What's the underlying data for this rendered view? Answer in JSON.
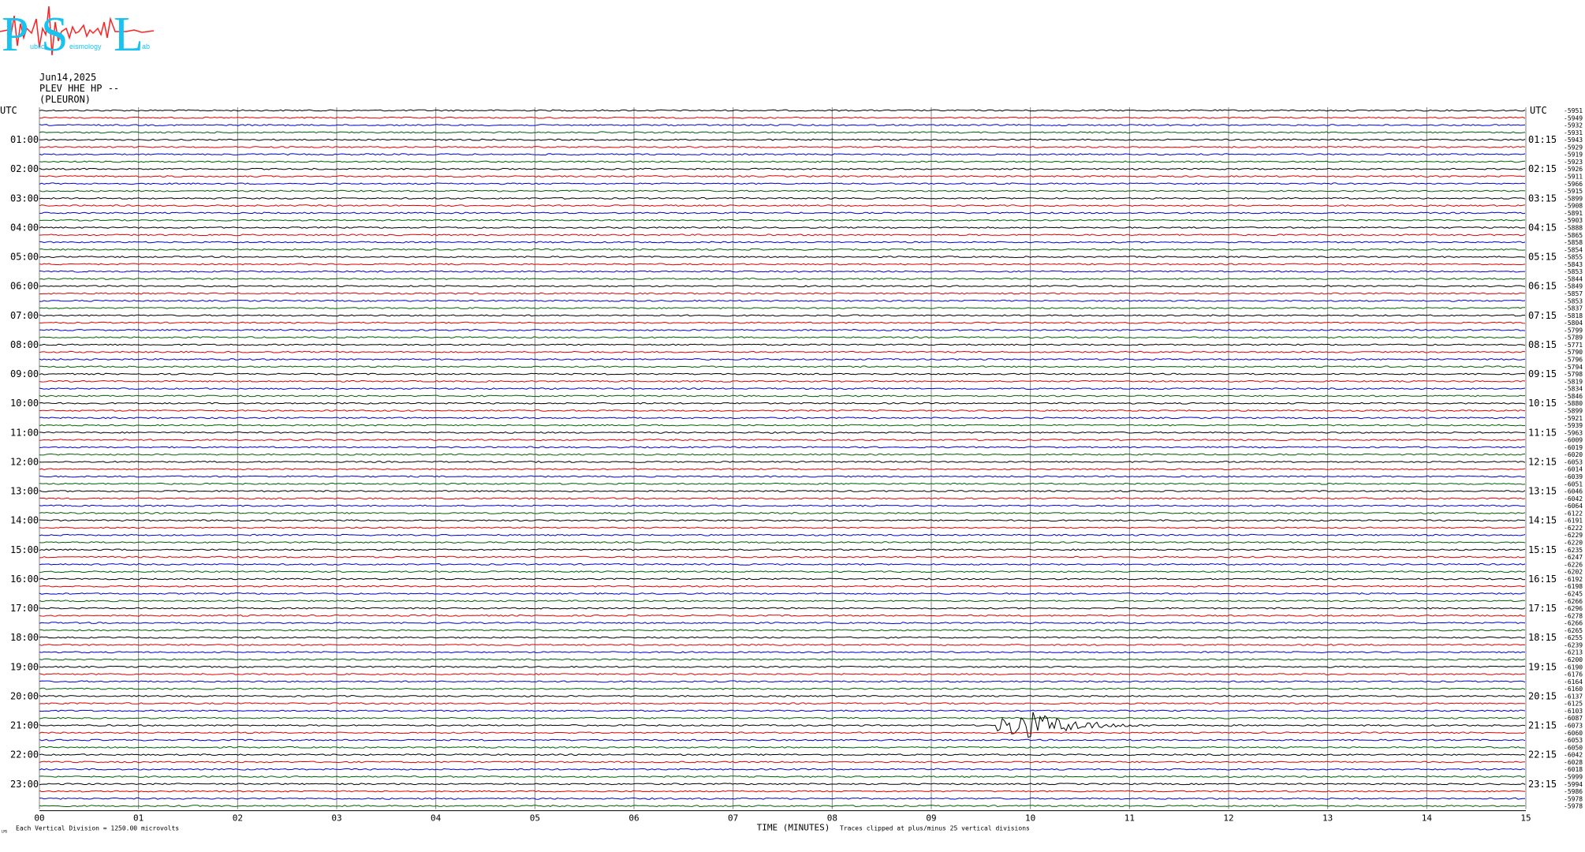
{
  "logo": {
    "letters": [
      "P",
      "S",
      "L"
    ],
    "words": [
      "ublic",
      "eismology",
      "ab"
    ]
  },
  "header": {
    "date": "Jun14,2025",
    "station": "PLEV HHE HP --",
    "location": "(PLEURON)"
  },
  "colors": {
    "row_cycle": [
      "#000000",
      "#e00000",
      "#0000d0",
      "#006000"
    ],
    "grid": "#808080",
    "logo_cyan": "#19c3f0",
    "logo_red": "#ff2020"
  },
  "chart_data": {
    "type": "helicorder",
    "title": "",
    "xlabel": "TIME (MINUTES)",
    "ylabel": "",
    "left_axis_title": "UTC",
    "right_axis_title": "UTC",
    "xlim": [
      0,
      15
    ],
    "x_ticks": [
      "00",
      "01",
      "02",
      "03",
      "04",
      "05",
      "06",
      "07",
      "08",
      "09",
      "10",
      "11",
      "12",
      "13",
      "14",
      "15"
    ],
    "rows": 96,
    "minutes_per_row": 15,
    "left_hour_labels": [
      "01:00",
      "02:00",
      "03:00",
      "04:00",
      "05:00",
      "06:00",
      "07:00",
      "08:00",
      "09:00",
      "10:00",
      "11:00",
      "12:00",
      "13:00",
      "14:00",
      "15:00",
      "16:00",
      "17:00",
      "18:00",
      "19:00",
      "20:00",
      "21:00",
      "22:00",
      "23:00"
    ],
    "right_hour_labels": [
      "01:15",
      "02:15",
      "03:15",
      "04:15",
      "05:15",
      "06:15",
      "07:15",
      "08:15",
      "09:15",
      "10:15",
      "11:15",
      "12:15",
      "13:15",
      "14:15",
      "15:15",
      "16:15",
      "17:15",
      "18:15",
      "19:15",
      "20:15",
      "21:15",
      "22:15",
      "23:15"
    ],
    "row_offsets": [
      -5951,
      -5949,
      -5932,
      -5931,
      -5943,
      -5929,
      -5919,
      -5923,
      -5926,
      -5911,
      -5966,
      -5915,
      -5899,
      -5908,
      -5891,
      -5903,
      -5888,
      -5865,
      -5858,
      -5854,
      -5855,
      -5843,
      -5853,
      -5844,
      -5849,
      -5857,
      -5853,
      -5837,
      -5818,
      -5804,
      -5799,
      -5789,
      -5771,
      -5790,
      -5796,
      -5794,
      -5798,
      -5819,
      -5834,
      -5846,
      -5880,
      -5899,
      -5921,
      -5939,
      -5963,
      -6009,
      -6019,
      -6020,
      -6053,
      -6014,
      -6039,
      -6051,
      -6046,
      -6042,
      -6064,
      -6122,
      -6191,
      -6222,
      -6229,
      -6220,
      -6235,
      -6247,
      -6226,
      -6202,
      -6192,
      -6198,
      -6245,
      -6266,
      -6296,
      -6278,
      -6266,
      -6265,
      -6255,
      -6239,
      -6213,
      -6200,
      -6190,
      -6176,
      -6164,
      -6160,
      -6137,
      -6125,
      -6103,
      -6087,
      -6073,
      -6060,
      -6053,
      -6050,
      -6042,
      -6028,
      -6018,
      -5999,
      -5994,
      -5986,
      -5978,
      -5978
    ],
    "events": [
      {
        "row": 84,
        "start_min": 9.65,
        "end_min": 11.9,
        "peak_min": 9.95,
        "peak_divisions": 2.2,
        "label": ""
      }
    ],
    "footer_left": "Each Vertical Division = 1250.00 microvolts",
    "footer_right": "Traces clipped at plus/minus 25 vertical divisions",
    "corner_mark": "LMS"
  }
}
